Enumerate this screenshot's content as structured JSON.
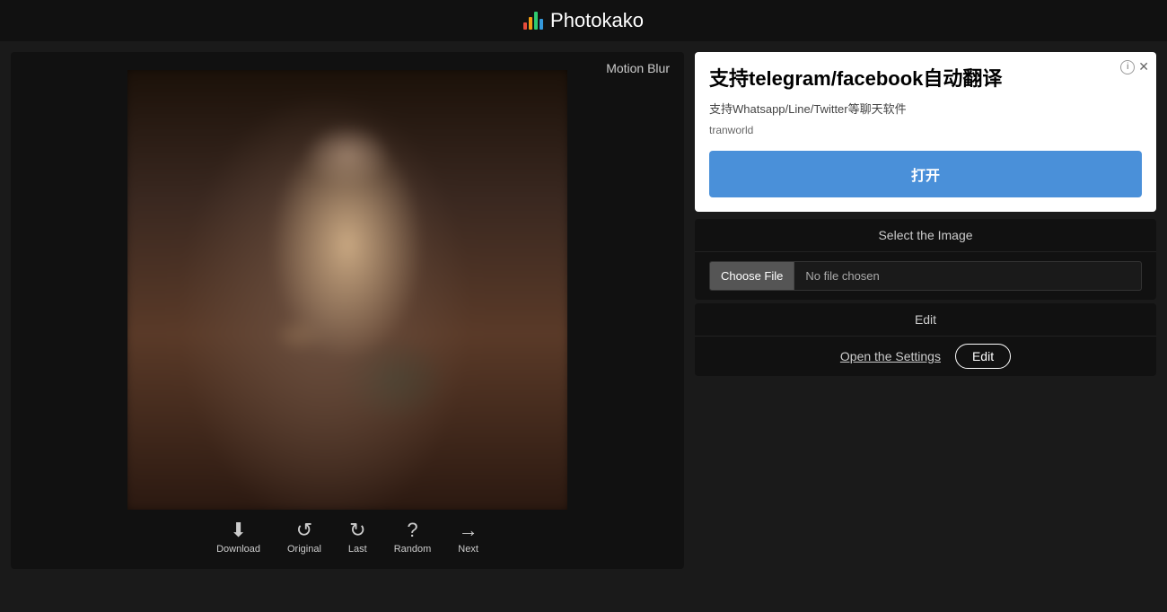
{
  "header": {
    "title": "Photokako",
    "logo_alt": "Photokako logo"
  },
  "panel": {
    "title": "Motion Blur"
  },
  "toolbar": {
    "items": [
      {
        "id": "download",
        "label": "Download",
        "icon": "⬇"
      },
      {
        "id": "original",
        "label": "Original",
        "icon": "↺"
      },
      {
        "id": "last",
        "label": "Last",
        "icon": "↻"
      },
      {
        "id": "random",
        "label": "Random",
        "icon": "?"
      },
      {
        "id": "next",
        "label": "Next",
        "icon": "→"
      }
    ]
  },
  "ad": {
    "title": "支持telegram/facebook自动翻译",
    "subtitle": "支持Whatsapp/Line/Twitter等聊天软件",
    "brand": "tranworld",
    "button_label": "打开"
  },
  "select_image": {
    "section_label": "Select the Image",
    "choose_file_label": "Choose File",
    "no_file_label": "No file chosen"
  },
  "edit": {
    "section_label": "Edit",
    "open_settings_label": "Open the Settings",
    "edit_button_label": "Edit"
  }
}
